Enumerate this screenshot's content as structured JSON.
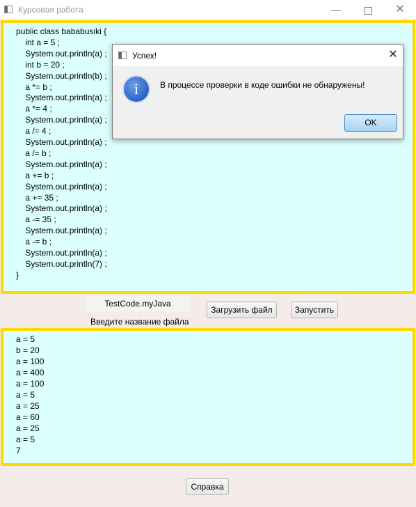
{
  "window": {
    "title": "Курсовая работа",
    "minimize": "—",
    "close": "✕"
  },
  "code": {
    "lines": [
      "public class bababusiki {",
      "    int a = 5 ;",
      "    System.out.println(a) ;",
      "    int b = 20 ;",
      "    System.out.println(b) ;",
      "    a *= b ;",
      "    System.out.println(a) ;",
      "    a *= 4 ;",
      "    System.out.println(a) ;",
      "    a /= 4 ;",
      "    System.out.println(a) ;",
      "    a /= b ;",
      "    System.out.println(a) ;",
      "    a += b ;",
      "    System.out.println(a) ;",
      "    a += 35 ;",
      "    System.out.println(a) ;",
      "    a -= 35 ;",
      "    System.out.println(a) ;",
      "    a -= b ;",
      "    System.out.println(a) ;",
      "    System.out.println(7) ;",
      "}"
    ]
  },
  "controls": {
    "filename_value": "TestCode.myJava",
    "filename_hint": "Введите название файла",
    "load_label": "Загрузить файл",
    "run_label": "Запустить",
    "help_label": "Справка"
  },
  "output": {
    "lines": [
      "a = 5",
      "b = 20",
      "a = 100",
      "a = 400",
      "a = 100",
      "a = 5",
      "a = 25",
      "a = 60",
      "a = 25",
      "a = 5",
      "7"
    ]
  },
  "dialog": {
    "title": "Успех!",
    "message": "В процессе проверки в коде ошибки не обнаружены!",
    "ok_label": "OK",
    "icon_glyph": "i",
    "close_glyph": "✕"
  }
}
